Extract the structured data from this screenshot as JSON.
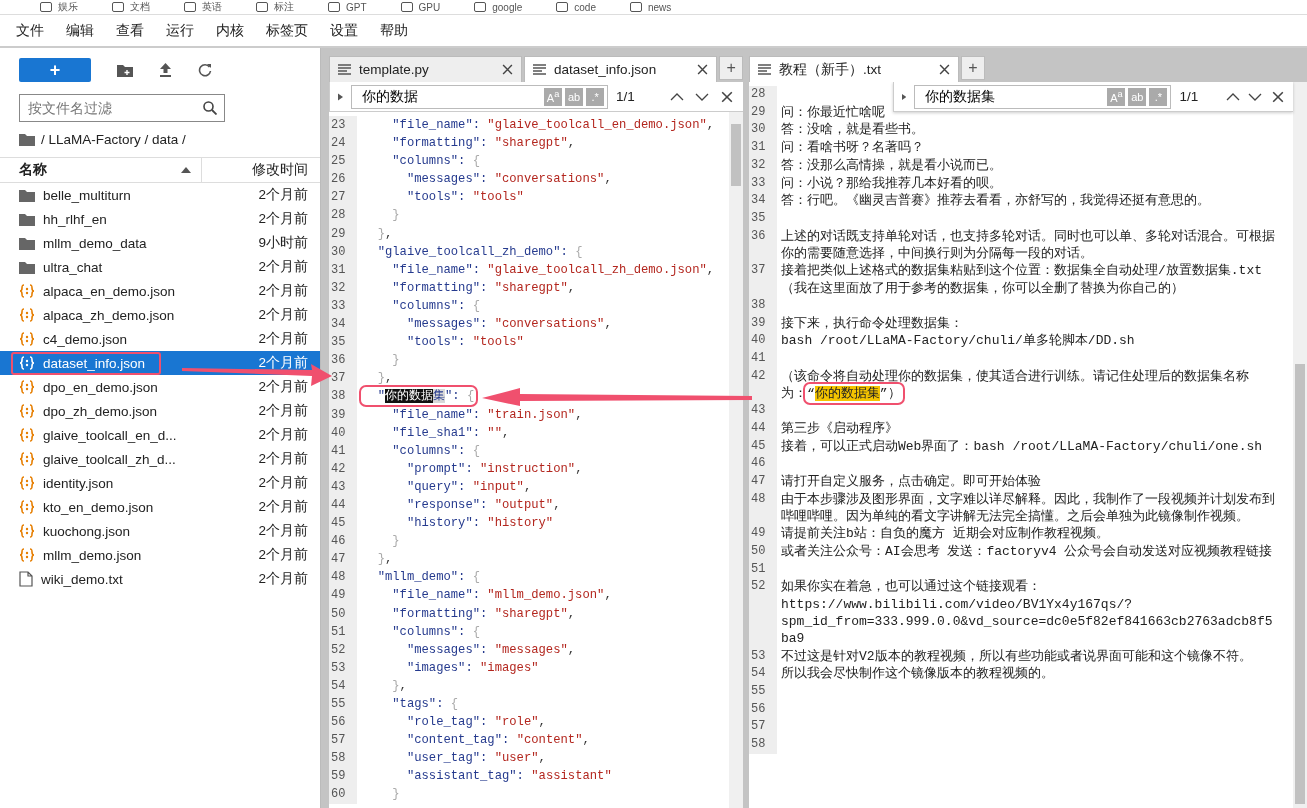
{
  "bookmarks": [
    "娱乐",
    "文档",
    "英语",
    "标注",
    "GPT",
    "GPU",
    "google",
    "code",
    "news"
  ],
  "menu": [
    "文件",
    "编辑",
    "查看",
    "运行",
    "内核",
    "标签页",
    "设置",
    "帮助"
  ],
  "file_browser": {
    "new_button": "+",
    "filter_placeholder": "按文件名过滤",
    "breadcrumb": "/ LLaMA-Factory / data /",
    "columns": [
      "名称",
      "修改时间"
    ],
    "items": [
      {
        "name": "belle_multiturn",
        "kind": "folder",
        "time": "2个月前",
        "selected": false,
        "boxed": false
      },
      {
        "name": "hh_rlhf_en",
        "kind": "folder",
        "time": "2个月前",
        "selected": false,
        "boxed": false
      },
      {
        "name": "mllm_demo_data",
        "kind": "folder",
        "time": "9小时前",
        "selected": false,
        "boxed": false
      },
      {
        "name": "ultra_chat",
        "kind": "folder",
        "time": "2个月前",
        "selected": false,
        "boxed": false
      },
      {
        "name": "alpaca_en_demo.json",
        "kind": "json",
        "time": "2个月前",
        "selected": false,
        "boxed": false
      },
      {
        "name": "alpaca_zh_demo.json",
        "kind": "json",
        "time": "2个月前",
        "selected": false,
        "boxed": false
      },
      {
        "name": "c4_demo.json",
        "kind": "json",
        "time": "2个月前",
        "selected": false,
        "boxed": false
      },
      {
        "name": "dataset_info.json",
        "kind": "json",
        "time": "2个月前",
        "selected": true,
        "boxed": true
      },
      {
        "name": "dpo_en_demo.json",
        "kind": "json",
        "time": "2个月前",
        "selected": false,
        "boxed": false
      },
      {
        "name": "dpo_zh_demo.json",
        "kind": "json",
        "time": "2个月前",
        "selected": false,
        "boxed": false
      },
      {
        "name": "glaive_toolcall_en_d...",
        "kind": "json",
        "time": "2个月前",
        "selected": false,
        "boxed": false
      },
      {
        "name": "glaive_toolcall_zh_d...",
        "kind": "json",
        "time": "2个月前",
        "selected": false,
        "boxed": false
      },
      {
        "name": "identity.json",
        "kind": "json",
        "time": "2个月前",
        "selected": false,
        "boxed": false
      },
      {
        "name": "kto_en_demo.json",
        "kind": "json",
        "time": "2个月前",
        "selected": false,
        "boxed": false
      },
      {
        "name": "kuochong.json",
        "kind": "json",
        "time": "2个月前",
        "selected": false,
        "boxed": false
      },
      {
        "name": "mllm_demo.json",
        "kind": "json",
        "time": "2个月前",
        "selected": false,
        "boxed": false
      },
      {
        "name": "wiki_demo.txt",
        "kind": "txt",
        "time": "2个月前",
        "selected": false,
        "boxed": false
      }
    ]
  },
  "code_panel": {
    "tabs": [
      {
        "label": "template.py",
        "selected": false
      },
      {
        "label": "dataset_info.json",
        "selected": true
      }
    ],
    "add_tab": "+",
    "find": {
      "query": "你的数据",
      "toggles": [
        {
          "label": "A$^{a}$",
          "on": false
        },
        {
          "label": "ab",
          "on": false
        },
        {
          "label": ".*",
          "on": false
        }
      ],
      "count": "1/1"
    },
    "lines": [
      {
        "no": "23",
        "text": "    \"file_name\": \"glaive_toolcall_en_demo.json\","
      },
      {
        "no": "24",
        "text": "    \"formatting\": \"sharegpt\","
      },
      {
        "no": "25",
        "text": "    \"columns\": {"
      },
      {
        "no": "26",
        "text": "      \"messages\": \"conversations\","
      },
      {
        "no": "27",
        "text": "      \"tools\": \"tools\""
      },
      {
        "no": "28",
        "text": "    }"
      },
      {
        "no": "29",
        "text": "  },"
      },
      {
        "no": "30",
        "text": "  \"glaive_toolcall_zh_demo\": {"
      },
      {
        "no": "31",
        "text": "    \"file_name\": \"glaive_toolcall_zh_demo.json\","
      },
      {
        "no": "32",
        "text": "    \"formatting\": \"sharegpt\","
      },
      {
        "no": "33",
        "text": "    \"columns\": {"
      },
      {
        "no": "34",
        "text": "      \"messages\": \"conversations\","
      },
      {
        "no": "35",
        "text": "      \"tools\": \"tools\""
      },
      {
        "no": "36",
        "text": "    }"
      },
      {
        "no": "37",
        "text": "  },"
      },
      {
        "no": "38",
        "segments": [
          {
            "text": "  \"",
            "kind": "key",
            "boxed": true
          },
          {
            "text": "你的数据",
            "kind": "selected",
            "boxed": true
          },
          {
            "text": "集",
            "kind": "partial",
            "boxed": true
          },
          {
            "text": "\": ",
            "kind": "key",
            "boxed": true
          },
          {
            "text": "{",
            "kind": "brace",
            "boxed": true
          }
        ]
      },
      {
        "no": "39",
        "text": "    \"file_name\": \"train.json\","
      },
      {
        "no": "40",
        "text": "    \"file_sha1\": \"\","
      },
      {
        "no": "41",
        "text": "    \"columns\": {"
      },
      {
        "no": "42",
        "text": "      \"prompt\": \"instruction\","
      },
      {
        "no": "43",
        "text": "      \"query\": \"input\","
      },
      {
        "no": "44",
        "text": "      \"response\": \"output\","
      },
      {
        "no": "45",
        "text": "      \"history\": \"history\""
      },
      {
        "no": "46",
        "text": "    }"
      },
      {
        "no": "47",
        "text": "  },"
      },
      {
        "no": "48",
        "text": "  \"mllm_demo\": {"
      },
      {
        "no": "49",
        "text": "    \"file_name\": \"mllm_demo.json\","
      },
      {
        "no": "50",
        "text": "    \"formatting\": \"sharegpt\","
      },
      {
        "no": "51",
        "text": "    \"columns\": {"
      },
      {
        "no": "52",
        "text": "      \"messages\": \"messages\","
      },
      {
        "no": "53",
        "text": "      \"images\": \"images\""
      },
      {
        "no": "54",
        "text": "    },"
      },
      {
        "no": "55",
        "text": "    \"tags\": {"
      },
      {
        "no": "56",
        "text": "      \"role_tag\": \"role\","
      },
      {
        "no": "57",
        "text": "      \"content_tag\": \"content\","
      },
      {
        "no": "58",
        "text": "      \"user_tag\": \"user\","
      },
      {
        "no": "59",
        "text": "      \"assistant_tag\": \"assistant\""
      },
      {
        "no": "60",
        "text": "    }"
      }
    ]
  },
  "text_panel": {
    "tabs": [
      {
        "label": "教程（新手）.txt",
        "selected": true
      }
    ],
    "add_tab": "+",
    "find": {
      "query": "你的数据集",
      "toggles": [
        {
          "label": "A$^{a}$",
          "on": false
        },
        {
          "label": "ab",
          "on": false
        },
        {
          "label": ".*",
          "on": false
        }
      ],
      "count": "1/1"
    },
    "lines": [
      {
        "no": "28"
      },
      {
        "no": "29",
        "text": "问：你最近忙啥呢"
      },
      {
        "no": "30",
        "text": "答：没啥，就是看些书。"
      },
      {
        "no": "31",
        "text": "问：看啥书呀？名著吗？"
      },
      {
        "no": "32",
        "text": "答：没那么高情操，就是看小说而已。"
      },
      {
        "no": "33",
        "text": "问：小说？那给我推荐几本好看的呗。"
      },
      {
        "no": "34",
        "text": "答：行吧。《幽灵吉普赛》推荐去看看，亦舒写的，我觉得还挺有意思的。"
      },
      {
        "no": "35"
      },
      {
        "no": "36",
        "text": "上述的对话既支持单轮对话，也支持多轮对话。同时也可以单、多轮对话混合。可根据你的需要随意选择，中间换行则为分隔每一段的对话。"
      },
      {
        "no": "37",
        "text": "接着把类似上述格式的数据集粘贴到这个位置：数据集全自动处理/放置数据集.txt  （我在这里面放了用于参考的数据集，你可以全删了替换为你自己的）"
      },
      {
        "no": "38"
      },
      {
        "no": "39",
        "text": "接下来，执行命令处理数据集："
      },
      {
        "no": "40",
        "text": "bash /root/LLaMA-Factory/chuli/单多轮脚本/DD.sh"
      },
      {
        "no": "41"
      },
      {
        "no": "42",
        "segments": [
          {
            "text": "（该命令将自动处理你的数据集，使其适合进行训练。请记住处理后的数据集名称为：",
            "kind": "plain",
            "boxed": false
          },
          {
            "text": "“",
            "kind": "plain",
            "boxed": true
          },
          {
            "text": "你的数据集",
            "kind": "match",
            "boxed": true
          },
          {
            "text": "”）",
            "kind": "plain",
            "boxed": true
          }
        ]
      },
      {
        "no": "43"
      },
      {
        "no": "44",
        "text": "第三步《启动程序》"
      },
      {
        "no": "45",
        "text": "接着，可以正式启动Web界面了：bash /root/LLaMA-Factory/chuli/one.sh"
      },
      {
        "no": "46"
      },
      {
        "no": "47",
        "text": "请打开自定义服务，点击确定。即可开始体验"
      },
      {
        "no": "48",
        "text": "由于本步骤涉及图形界面，文字难以详尽解释。因此，我制作了一段视频并计划发布到哔哩哔哩。因为单纯的看文字讲解无法完全搞懂。之后会单独为此镜像制作视频。"
      },
      {
        "no": "49",
        "text": "请提前关注b站：自负的魔方 近期会对应制作教程视频。"
      },
      {
        "no": "50",
        "text": "或者关注公众号：AI会思考 发送：factoryv4 公众号会自动发送对应视频教程链接"
      },
      {
        "no": "51"
      },
      {
        "no": "52",
        "text": "如果你实在着急，也可以通过这个链接观看：https://www.bilibili.com/video/BV1Yx4y167qs/?spm_id_from=333.999.0.0&vd_source=dc0e5f82ef841663cb2763adcb8f5ba9"
      },
      {
        "no": "53",
        "text": "不过这是针对V2版本的教程视频，所以有些功能或者说界面可能和这个镜像不符。"
      },
      {
        "no": "54",
        "text": "所以我会尽快制作这个镜像版本的教程视频的。"
      },
      {
        "no": "55"
      },
      {
        "no": "56"
      },
      {
        "no": "57"
      },
      {
        "no": "58"
      }
    ]
  }
}
